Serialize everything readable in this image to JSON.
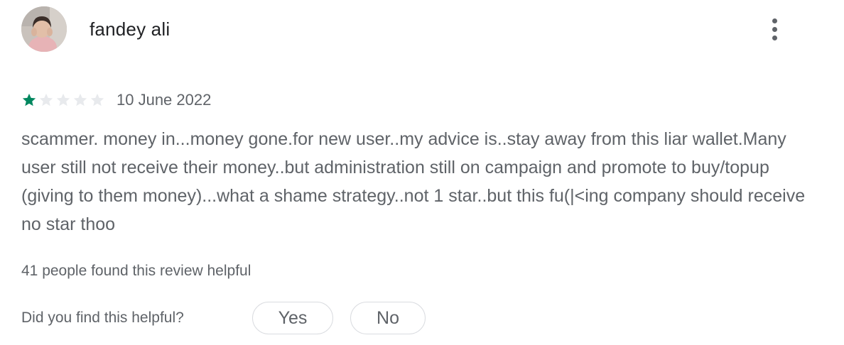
{
  "review": {
    "author": "fandey ali",
    "avatar_icon": "user-avatar-photo",
    "more_icon": "more-vertical-icon",
    "rating": 1,
    "rating_max": 5,
    "star_filled_color": "#01875f",
    "star_empty_color": "#e8eaed",
    "date": "10 June 2022",
    "text": "scammer. money in...money gone.for new user..my advice is..stay away from this liar wallet.Many user still not receive their money..but administration still on campaign and promote to buy/topup (giving to them money)...what a shame strategy..not 1 star..but this fu(|<ing company should receive no star thoo",
    "helpful_count_text": "41 people found this review helpful"
  },
  "feedback": {
    "question": "Did you find this helpful?",
    "yes_label": "Yes",
    "no_label": "No"
  }
}
